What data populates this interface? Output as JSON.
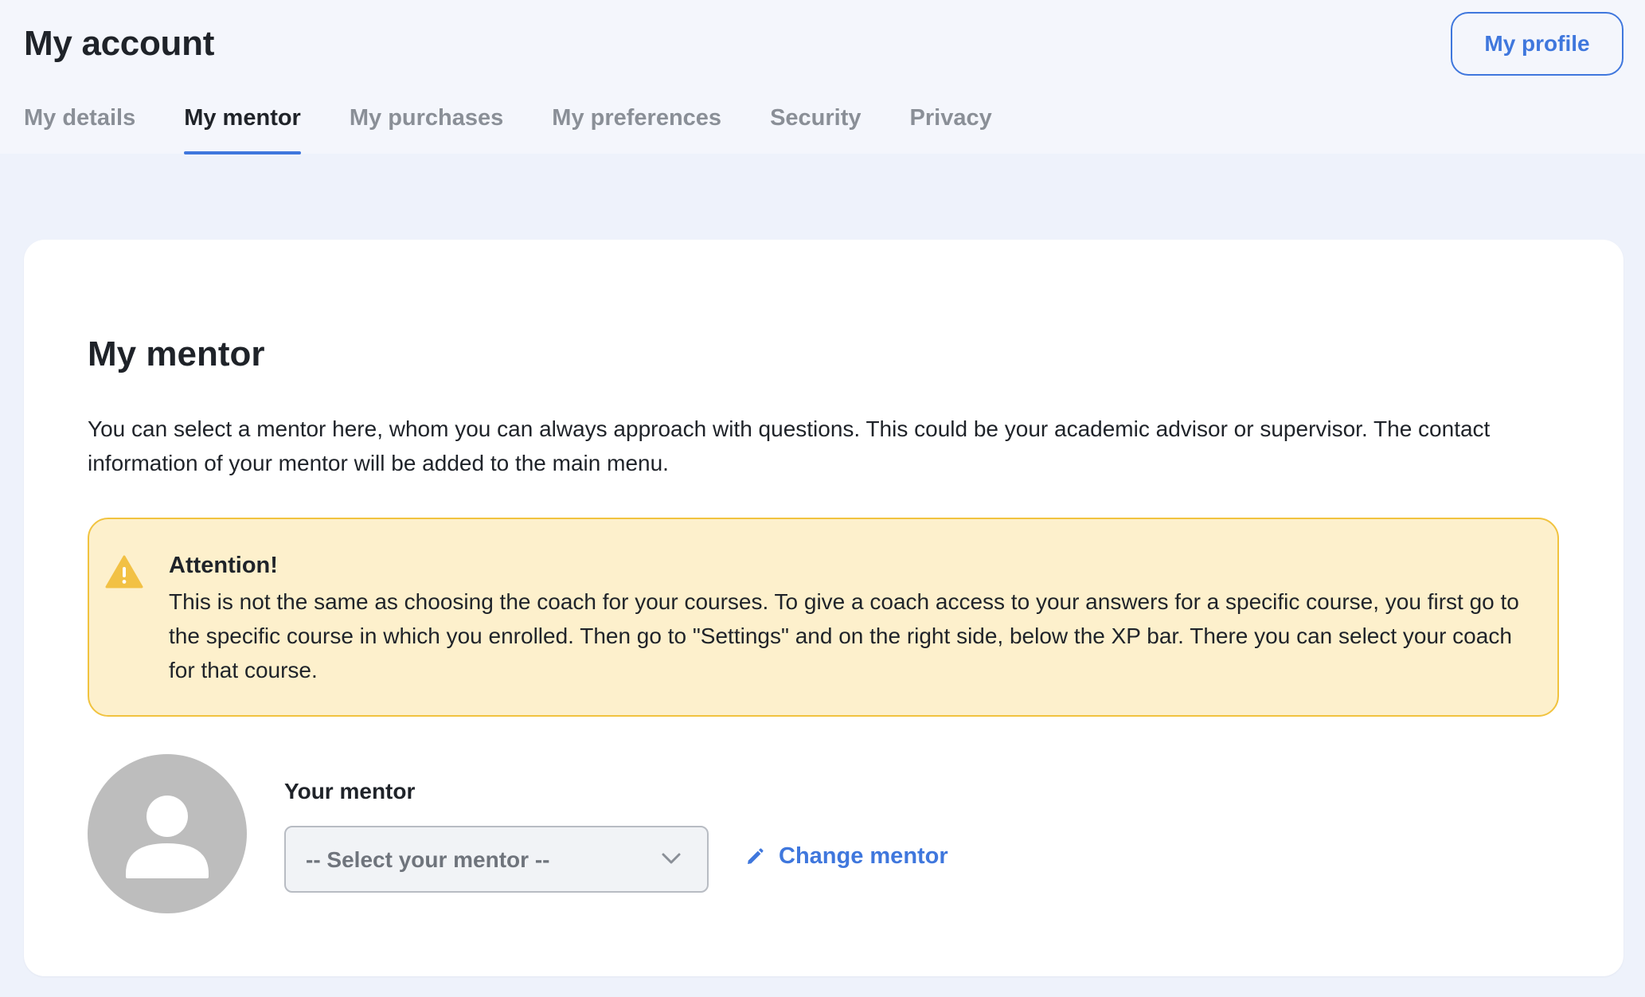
{
  "header": {
    "title": "My account",
    "profile_button": "My profile"
  },
  "tabs": [
    {
      "label": "My details",
      "active": false
    },
    {
      "label": "My mentor",
      "active": true
    },
    {
      "label": "My purchases",
      "active": false
    },
    {
      "label": "My preferences",
      "active": false
    },
    {
      "label": "Security",
      "active": false
    },
    {
      "label": "Privacy",
      "active": false
    }
  ],
  "card": {
    "title": "My mentor",
    "intro": "You can select a mentor here, whom you can always approach with questions. This could be your academic advisor or supervisor. The contact information of your mentor will be added to the main menu.",
    "alert": {
      "icon": "warning-icon",
      "title": "Attention!",
      "body": "This is not the same as choosing the coach for your courses. To give a coach access to your answers for a specific course, you first go to the specific course in which you enrolled. Then go to \"Settings\" and on the right side, below the XP bar. There you can select your coach for that course."
    },
    "mentor": {
      "avatar_icon": "user-placeholder-icon",
      "label": "Your mentor",
      "select_value": "-- Select your mentor --",
      "change_label": "Change mentor"
    }
  },
  "colors": {
    "accent": "#3f77dd",
    "page_bg": "#eef2fb",
    "header_bg": "#f4f6fc",
    "alert_bg": "#fdf0cc",
    "alert_border": "#f1c33f",
    "warning_icon": "#f2c144",
    "avatar_bg": "#bdbdbd"
  }
}
